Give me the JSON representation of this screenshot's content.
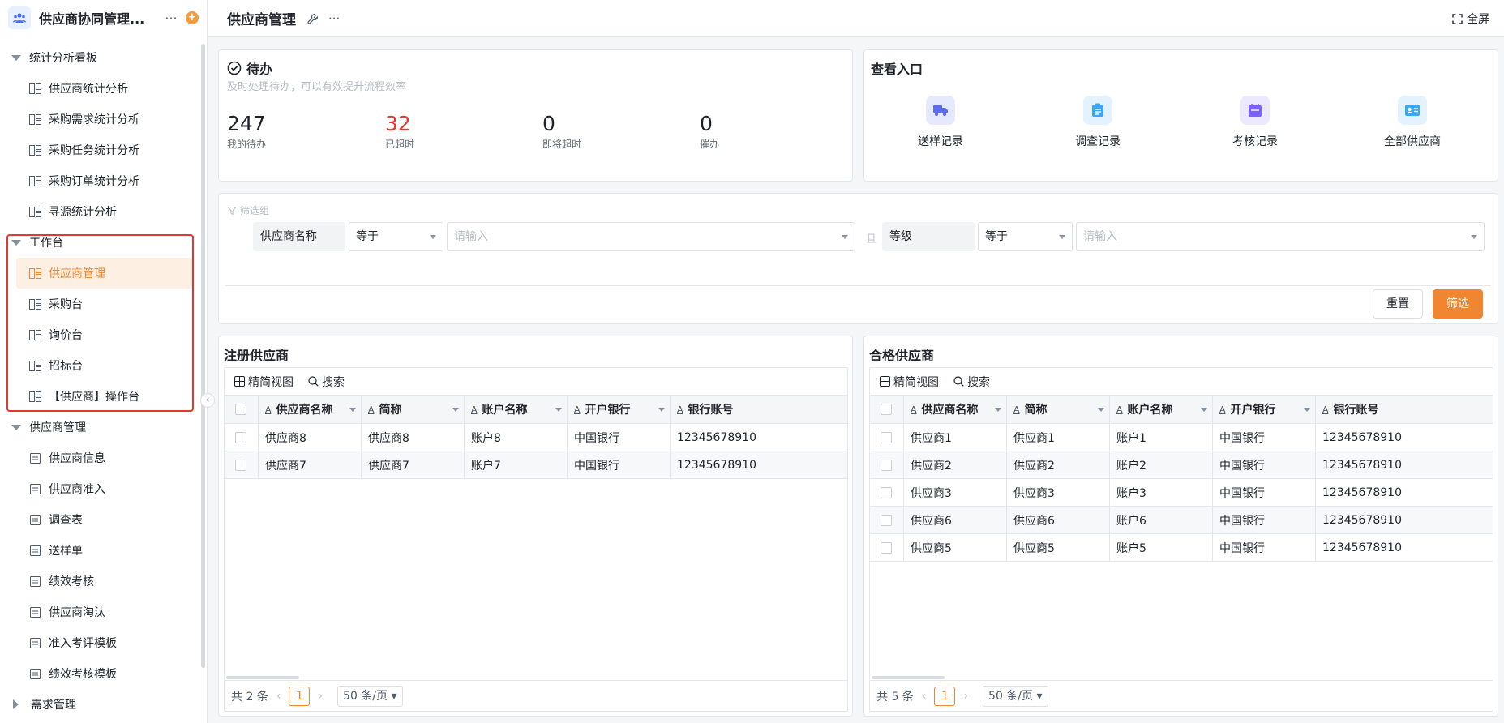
{
  "app": {
    "title": "供应商协同管理...",
    "more": "···",
    "add": "+"
  },
  "sidebar": {
    "groups": [
      {
        "label": "统计分析看板",
        "items": [
          "供应商统计分析",
          "采购需求统计分析",
          "采购任务统计分析",
          "采购订单统计分析",
          "寻源统计分析"
        ]
      },
      {
        "label": "工作台",
        "items": [
          "供应商管理",
          "采购台",
          "询价台",
          "招标台",
          "【供应商】操作台"
        ]
      },
      {
        "label": "供应商管理",
        "items": [
          "供应商信息",
          "供应商准入",
          "调查表",
          "送样单",
          "绩效考核",
          "供应商淘汰",
          "准入考评模板",
          "绩效考核模板"
        ]
      },
      {
        "label": "需求管理"
      }
    ],
    "active_item": "供应商管理",
    "collapse_icon": "‹"
  },
  "topbar": {
    "title": "供应商管理",
    "more": "···",
    "fullscreen": "全屏"
  },
  "todo": {
    "title": "待办",
    "subtitle": "及时处理待办，可以有效提升流程效率",
    "stats": [
      {
        "value": "247",
        "label": "我的待办"
      },
      {
        "value": "32",
        "label": "已超时"
      },
      {
        "value": "0",
        "label": "即将超时"
      },
      {
        "value": "0",
        "label": "催办"
      }
    ]
  },
  "entry": {
    "title": "查看入口",
    "items": [
      {
        "label": "送样记录",
        "icon": "truck-icon",
        "color": "#5b6cf0"
      },
      {
        "label": "调查记录",
        "icon": "clipboard-icon",
        "color": "#3aa6f5"
      },
      {
        "label": "考核记录",
        "icon": "calendar-icon",
        "color": "#7b61ff"
      },
      {
        "label": "全部供应商",
        "icon": "id-card-icon",
        "color": "#3aa6f5"
      }
    ]
  },
  "filter": {
    "label": "筛选组",
    "conditions": [
      {
        "field": "供应商名称",
        "operator": "等于",
        "placeholder": "请输入"
      },
      {
        "field": "等级",
        "operator": "等于",
        "placeholder": "请输入"
      }
    ],
    "connector": "且",
    "reset": "重置",
    "submit": "筛选"
  },
  "tables": {
    "registered": {
      "title": "注册供应商",
      "toolbar": {
        "view": "精简视图",
        "search": "搜索"
      },
      "columns": [
        "供应商名称",
        "简称",
        "账户名称",
        "开户银行",
        "银行账号"
      ],
      "rows": [
        [
          "供应商8",
          "供应商8",
          "账户8",
          "中国银行",
          "12345678910"
        ],
        [
          "供应商7",
          "供应商7",
          "账户7",
          "中国银行",
          "12345678910"
        ]
      ],
      "pager": {
        "total": "共 2 条",
        "page": "1",
        "size": "50 条/页"
      }
    },
    "qualified": {
      "title": "合格供应商",
      "toolbar": {
        "view": "精简视图",
        "search": "搜索"
      },
      "columns": [
        "供应商名称",
        "简称",
        "账户名称",
        "开户银行",
        "银行账号"
      ],
      "rows": [
        [
          "供应商1",
          "供应商1",
          "账户1",
          "中国银行",
          "12345678910"
        ],
        [
          "供应商2",
          "供应商2",
          "账户2",
          "中国银行",
          "12345678910"
        ],
        [
          "供应商3",
          "供应商3",
          "账户3",
          "中国银行",
          "12345678910"
        ],
        [
          "供应商6",
          "供应商6",
          "账户6",
          "中国银行",
          "12345678910"
        ],
        [
          "供应商5",
          "供应商5",
          "账户5",
          "中国银行",
          "12345678910"
        ]
      ],
      "pager": {
        "total": "共 5 条",
        "page": "1",
        "size": "50 条/页"
      }
    }
  },
  "colors": {
    "accent": "#f0862f",
    "danger": "#e5372f",
    "highlight": "#e5372f"
  }
}
